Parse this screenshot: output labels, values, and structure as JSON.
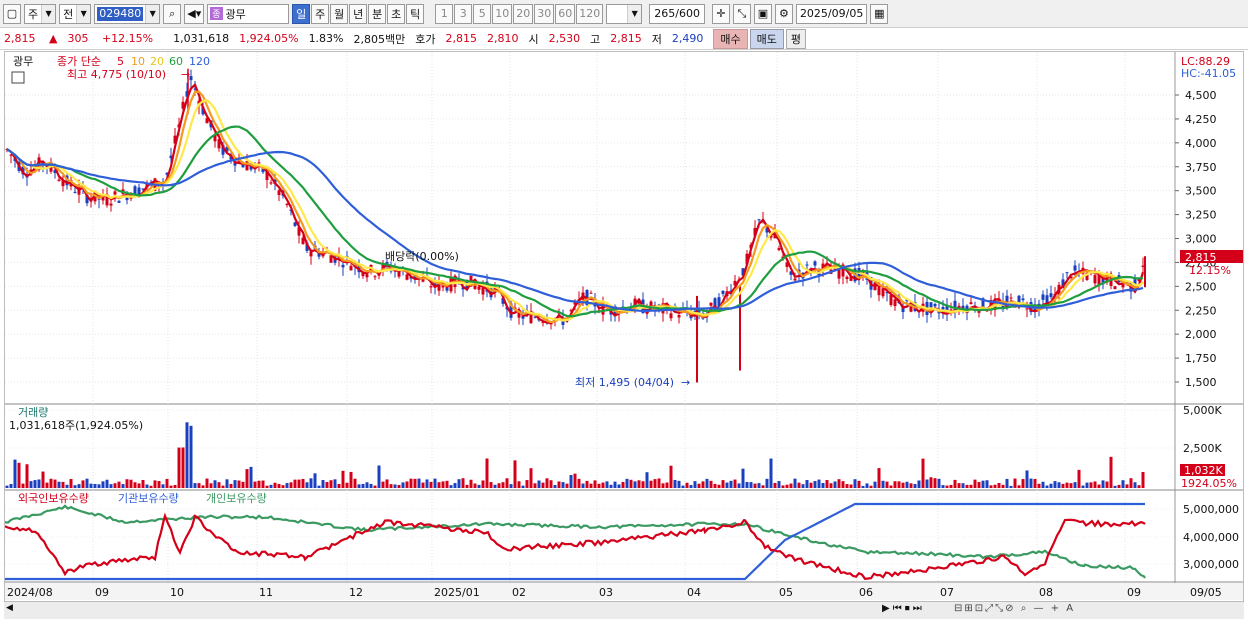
{
  "toolbar": {
    "period_label": "주",
    "prev_label": "전",
    "stock_code": "029480",
    "stock_name": "광무",
    "stock_tag": "종",
    "timeframes": [
      "일",
      "주",
      "월",
      "년",
      "분",
      "초",
      "틱"
    ],
    "selected_timeframe": "일",
    "intervals": [
      "1",
      "3",
      "5",
      "10",
      "20",
      "30",
      "60",
      "120"
    ],
    "page_count": "265",
    "page_total": "/600",
    "date": "2025/09/05"
  },
  "quote": {
    "price": "2,815",
    "change": "305",
    "change_pct": "+12.15%",
    "volume": "1,031,618",
    "volume_pct": "1,924.05%",
    "turnover": "1.83%",
    "trade_value": "2,805백만",
    "bid_label": "호가",
    "ask": "2,815",
    "bid": "2,810",
    "open_label": "시",
    "open": "2,530",
    "high_label": "고",
    "high": "2,815",
    "low_label": "저",
    "low": "2,490",
    "buy_label": "매수",
    "sell_label": "매도",
    "eval_label": "평"
  },
  "chart": {
    "name_label": "광무",
    "legend_main": "종가 단순",
    "ma_periods": [
      "5",
      "10",
      "20",
      "60",
      "120"
    ],
    "max_label": "최고 4,775 (10/10)",
    "min_label": "최저 1,495 (04/04)",
    "dividend_label": "배당락(0.00%)",
    "lc_label": "LC:88.29",
    "hc_label": "HC:-41.05",
    "price_ticks": [
      "4,500",
      "4,250",
      "4,000",
      "3,750",
      "3,500",
      "3,250",
      "3,000",
      "2,750",
      "2,500",
      "2,250",
      "2,000",
      "1,750",
      "1,500"
    ],
    "last_price_tag": "2,815",
    "last_pct_tag": "12.15%",
    "volume_label": "거래량",
    "volume_value": "1,031,618주(1,924.05%)",
    "volume_ticks": [
      "5,000K",
      "2,500K"
    ],
    "volume_tag": "1,032K",
    "volume_pct_tag": "1924.05%",
    "holdings_legend": [
      "외국인보유수량",
      "기관보유수량",
      "개인보유수량"
    ],
    "holdings_ticks": [
      "5,000,000",
      "4,000,000",
      "3,000,000"
    ],
    "x_ticks": [
      "2024/08",
      "09",
      "10",
      "11",
      "12",
      "2025/01",
      "02",
      "03",
      "04",
      "05",
      "06",
      "07",
      "08",
      "09",
      "09/05"
    ]
  },
  "colors": {
    "up": "#d4001a",
    "down": "#1a3fbf",
    "ma5": "#d4001a",
    "ma10": "#f39a1f",
    "ma20": "#ffe94a",
    "ma60": "#1e9e3e",
    "ma120": "#2f5fd8",
    "foreign": "#d4001a",
    "institution": "#2f5fd8",
    "individual": "#3a9a62"
  }
}
